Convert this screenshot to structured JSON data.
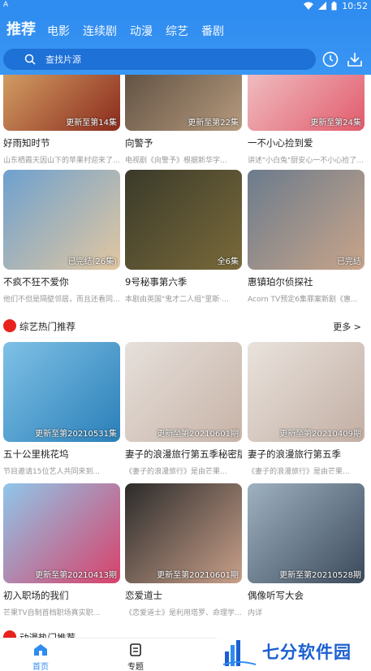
{
  "status": {
    "time": "10:52",
    "left_text": "A"
  },
  "header": {
    "tabs": [
      {
        "label": "推荐",
        "active": true
      },
      {
        "label": "电影",
        "active": false
      },
      {
        "label": "连续剧",
        "active": false
      },
      {
        "label": "动漫",
        "active": false
      },
      {
        "label": "综艺",
        "active": false
      },
      {
        "label": "番剧",
        "active": false
      }
    ],
    "search_placeholder": "查找片源"
  },
  "rows": [
    [
      {
        "title": "好雨知时节",
        "desc": "山东栖霞天因山下的苹果村迎来了...",
        "badge": "更新至第14集",
        "colors": [
          "#d9a96a",
          "#8b2a1c"
        ]
      },
      {
        "title": "向警予",
        "desc": "电视剧《向警予》根据新华字...",
        "badge": "更新至第22集",
        "colors": [
          "#5a4b3e",
          "#b59a7d"
        ]
      },
      {
        "title": "一不小心捡到爱",
        "desc": "讲述\"小白兔\"厨安心一不小心捡了...",
        "badge": "更新至第24集",
        "colors": [
          "#f0c7c9",
          "#e25b6c"
        ]
      }
    ],
    [
      {
        "title": "不疯不狂不爱你",
        "desc": "他们不但是隔壁邻居，而且还看同...",
        "badge": "已完结(26集)",
        "colors": [
          "#6ea1cf",
          "#e2c7a0"
        ]
      },
      {
        "title": "9号秘事第六季",
        "desc": "本剧由英国\"鬼才二人组\"里斯·...",
        "badge": "全6集",
        "colors": [
          "#3a3a2a",
          "#7a6a3a"
        ]
      },
      {
        "title": "惠镇珀尔侦探社",
        "desc": "Acorn TV预定6集罪案新剧《惠...",
        "badge": "已完结",
        "colors": [
          "#6b7b8c",
          "#c9a58a"
        ]
      }
    ],
    [
      {
        "title": "五十公里桃花坞",
        "desc": "节目邀请15位艺人共同来到...",
        "badge": "更新至第20210531集",
        "colors": [
          "#7fc1e6",
          "#2a7fb8"
        ]
      },
      {
        "title": "妻子的浪漫旅行第五季秘密版",
        "desc": "《妻子的浪漫旅行》是由芒果...",
        "badge": "更新至第20210601期",
        "colors": [
          "#e6e0db",
          "#c7b3a7"
        ]
      },
      {
        "title": "妻子的浪漫旅行第五季",
        "desc": "《妻子的浪漫旅行》是由芒果...",
        "badge": "更新至第20210409期",
        "colors": [
          "#e9e3dd",
          "#c2aea3"
        ]
      }
    ],
    [
      {
        "title": "初入职场的我们",
        "desc": "芒果TV自制首档职场真实职...",
        "badge": "更新至第20210413期",
        "colors": [
          "#8fc7ea",
          "#d8416a"
        ]
      },
      {
        "title": "恋爱道士",
        "desc": "《恋爱道士》是利用塔罗、命理学...",
        "badge": "更新至第20210601期",
        "colors": [
          "#2b2b2b",
          "#c9a08a"
        ]
      },
      {
        "title": "偶像听写大会",
        "desc": "内详",
        "badge": "更新至第20210528期",
        "colors": [
          "#9fb2c2",
          "#3b4a5a"
        ]
      }
    ]
  ],
  "sections": [
    {
      "title": "综艺热门推荐",
      "more": "更多 >"
    },
    {
      "title": "动漫热门推荐",
      "more": ""
    }
  ],
  "bottom_nav": [
    {
      "label": "首页",
      "icon": "home-icon",
      "active": true
    },
    {
      "label": "专题",
      "icon": "topic-icon",
      "active": false
    }
  ],
  "watermark": "七分软件园",
  "colors": {
    "accent": "#2f8cf0",
    "search_bg": "#1e71d6",
    "section_dot": "#e8231c",
    "nav_active": "#2f8cf0"
  }
}
